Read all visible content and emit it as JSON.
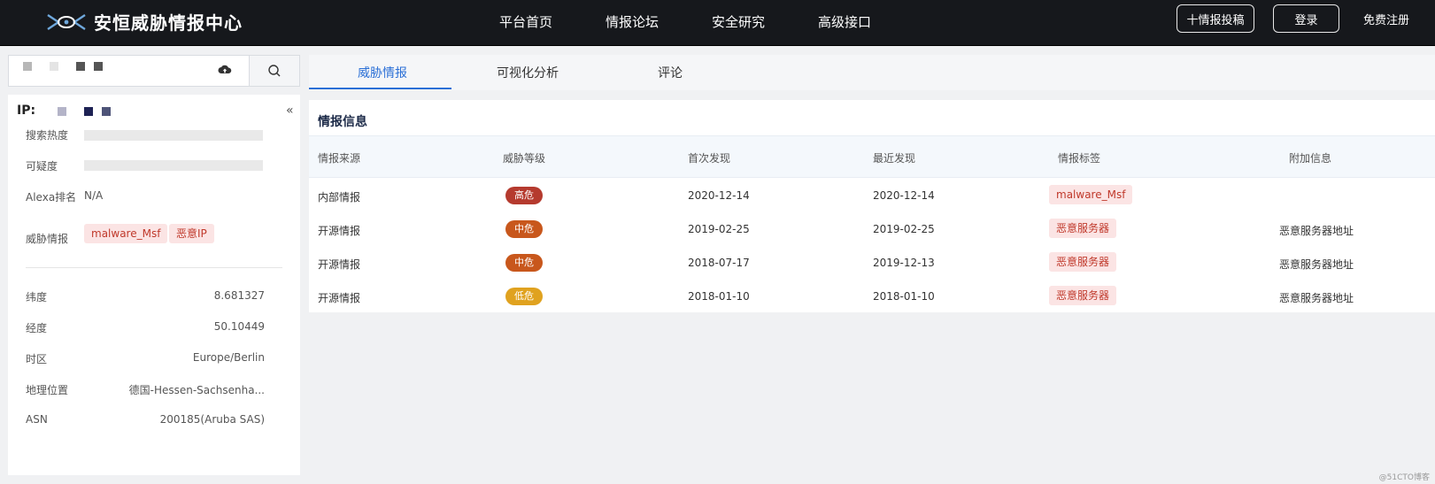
{
  "header": {
    "logo_text": "安恒威胁情报中心",
    "nav": [
      "平台首页",
      "情报论坛",
      "安全研究",
      "高级接口"
    ],
    "submit_label": "十情报投稿",
    "login_label": "登录",
    "register_label": "免费注册"
  },
  "search": {
    "value": "",
    "upload_icon": "cloud-upload-icon",
    "search_icon": "search-icon"
  },
  "sidebar": {
    "ip_label": "IP:",
    "collapse_label": "«",
    "search_heat_label": "搜索热度",
    "suspicion_label": "可疑度",
    "alexa_label": "Alexa排名",
    "alexa_value": "N/A",
    "threat_label": "威胁情报",
    "threat_tags": [
      "malware_Msf",
      "恶意IP"
    ],
    "details": [
      {
        "label": "纬度",
        "value": "8.681327"
      },
      {
        "label": "经度",
        "value": "50.10449"
      },
      {
        "label": "时区",
        "value": "Europe/Berlin"
      },
      {
        "label": "地理位置",
        "value": "德国-Hessen-Sachsenha..."
      },
      {
        "label": "ASN",
        "value": "200185(Aruba SAS)"
      }
    ]
  },
  "tabs": [
    "威胁情报",
    "可视化分析",
    "评论"
  ],
  "intel": {
    "title": "情报信息",
    "columns": [
      "情报来源",
      "威胁等级",
      "首次发现",
      "最近发现",
      "情报标签",
      "附加信息"
    ],
    "rows": [
      {
        "source": "内部情报",
        "level": "高危",
        "level_color": "#b53a2e",
        "first": "2020-12-14",
        "last": "2020-12-14",
        "tag": "malware_Msf",
        "extra": ""
      },
      {
        "source": "开源情报",
        "level": "中危",
        "level_color": "#c8571c",
        "first": "2019-02-25",
        "last": "2019-02-25",
        "tag": "恶意服务器",
        "extra": "恶意服务器地址"
      },
      {
        "source": "开源情报",
        "level": "中危",
        "level_color": "#c8571c",
        "first": "2018-07-17",
        "last": "2019-12-13",
        "tag": "恶意服务器",
        "extra": "恶意服务器地址"
      },
      {
        "source": "开源情报",
        "level": "低危",
        "level_color": "#e0a21f",
        "first": "2018-01-10",
        "last": "2018-01-10",
        "tag": "恶意服务器",
        "extra": "恶意服务器地址"
      }
    ]
  },
  "watermark": "@51CTO博客"
}
